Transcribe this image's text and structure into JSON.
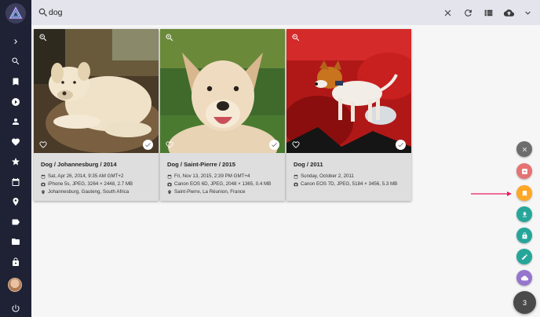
{
  "search": {
    "value": "dog"
  },
  "sidebar": {
    "items": [
      {
        "name": "expand",
        "icon": "chevron-right-icon"
      },
      {
        "name": "search",
        "icon": "search-icon"
      },
      {
        "name": "albums",
        "icon": "bookmark-icon"
      },
      {
        "name": "videos",
        "icon": "play-icon"
      },
      {
        "name": "people",
        "icon": "person-icon"
      },
      {
        "name": "favorites",
        "icon": "heart-icon"
      },
      {
        "name": "moments",
        "icon": "star-icon"
      },
      {
        "name": "calendar",
        "icon": "calendar-icon"
      },
      {
        "name": "places",
        "icon": "map-pin-icon"
      },
      {
        "name": "labels",
        "icon": "label-icon"
      },
      {
        "name": "folders",
        "icon": "folder-icon"
      },
      {
        "name": "private",
        "icon": "lock-icon"
      },
      {
        "name": "account",
        "icon": "avatar"
      },
      {
        "name": "logout",
        "icon": "power-icon"
      }
    ]
  },
  "toolbar": {
    "icons": [
      "close-icon",
      "refresh-icon",
      "list-view-icon",
      "upload-icon",
      "expand-more-icon"
    ]
  },
  "photos": [
    {
      "title": "Dog / Johannesburg / 2014",
      "date": "Sat, Apr 26, 2014, 9:35 AM GMT+2",
      "camera": "iPhone 5s, JPEG, 3264 × 2448, 2.7 MB",
      "location": "Johannesburg, Gauteng, South Africa"
    },
    {
      "title": "Dog / Saint-Pierre / 2015",
      "date": "Fri, Nov 13, 2015, 2:39 PM GMT+4",
      "camera": "Canon EOS 6D, JPEG, 2048 × 1365, 0.4 MB",
      "location": "Saint-Pierre, La Réunion, France"
    },
    {
      "title": "Dog / 2011",
      "date": "Sunday, October 2, 2011",
      "camera": "Canon EOS 7D, JPEG, 5184 × 3456, 5.3 MB",
      "location": ""
    }
  ],
  "fab": {
    "actions": [
      {
        "name": "clear-selection",
        "icon": "close-icon",
        "color": "#6d6d6d"
      },
      {
        "name": "private",
        "icon": "private-icon",
        "color": "#e57373"
      },
      {
        "name": "add-to-album",
        "icon": "bookmark-icon",
        "color": "#ffa726"
      },
      {
        "name": "download",
        "icon": "download-icon",
        "color": "#26a69a"
      },
      {
        "name": "lock",
        "icon": "lock-icon",
        "color": "#26a69a"
      },
      {
        "name": "edit",
        "icon": "pencil-icon",
        "color": "#26a69a"
      },
      {
        "name": "share",
        "icon": "cloud-icon",
        "color": "#9575cd"
      }
    ],
    "selected_count": "3"
  },
  "colors": {
    "sidebar": "#1f2235",
    "topbar": "#e3e4ec",
    "arrow": "#e91e63"
  }
}
